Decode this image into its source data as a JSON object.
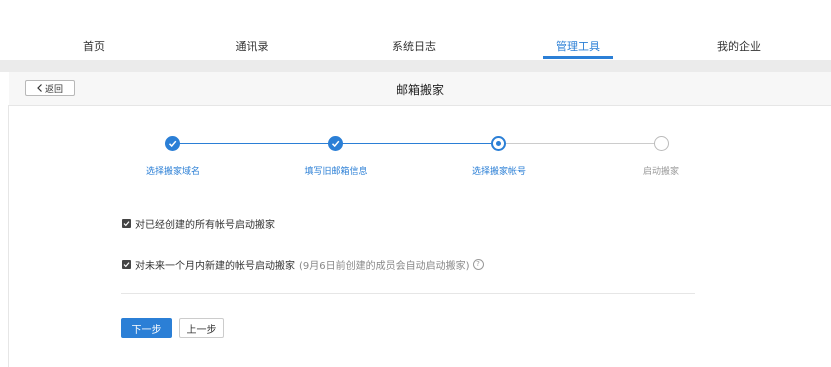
{
  "nav": {
    "items": [
      "首页",
      "通讯录",
      "系统日志",
      "管理工具",
      "我的企业"
    ],
    "active_index": 3
  },
  "header": {
    "back_label": "返回",
    "title": "邮箱搬家"
  },
  "steps": [
    {
      "label": "选择搬家域名",
      "state": "done"
    },
    {
      "label": "填写旧邮箱信息",
      "state": "done"
    },
    {
      "label": "选择搬家帐号",
      "state": "current"
    },
    {
      "label": "启动搬家",
      "state": "todo"
    }
  ],
  "options": {
    "existing_label": "对已经创建的所有帐号启动搬家",
    "existing_checked": true,
    "future_label": "对未来一个月内新建的帐号启动搬家",
    "future_note": "(9月6日前创建的成员会自动启动搬家)",
    "future_checked": true
  },
  "buttons": {
    "next": "下一步",
    "prev": "上一步"
  },
  "colors": {
    "accent": "#2b7fd6"
  }
}
